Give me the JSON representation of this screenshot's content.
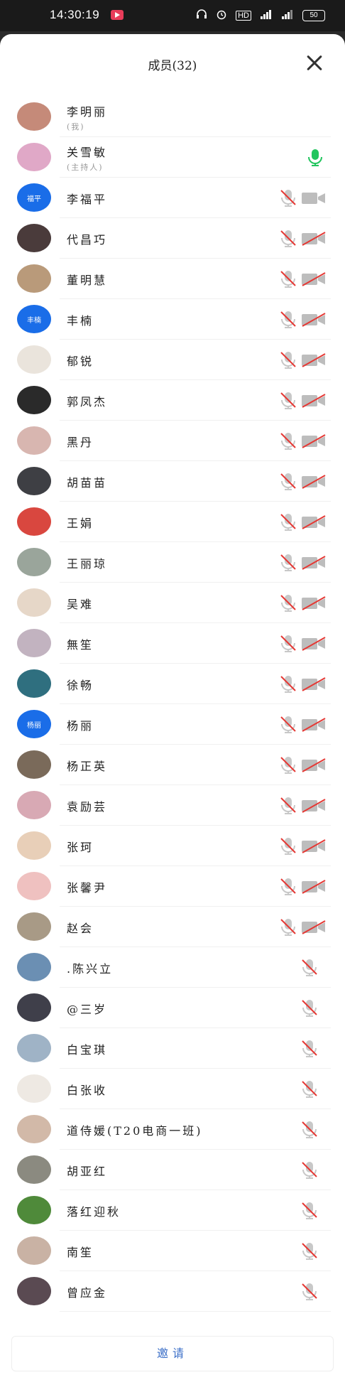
{
  "status": {
    "time": "14:30:19",
    "battery": "50"
  },
  "header": {
    "title": "成员(32)"
  },
  "invite_label": "邀请",
  "colors": {
    "accent": "#3a6ec7",
    "mic_on": "#22c55e",
    "muted_red": "#e53935",
    "text_badge": "#1a6de8"
  },
  "members": [
    {
      "name": "李明丽",
      "sub": "(我)",
      "avatar": {
        "bg": "#c58a79",
        "text": ""
      },
      "mic": "none",
      "cam": "none"
    },
    {
      "name": "关雪敏",
      "sub": "(主持人)",
      "avatar": {
        "bg": "#e0a8c7",
        "text": ""
      },
      "mic": "on",
      "cam": "none"
    },
    {
      "name": "李福平",
      "avatar": {
        "bg": "#1a6de8",
        "text": "福平"
      },
      "mic": "muted",
      "cam": "on"
    },
    {
      "name": "代昌巧",
      "avatar": {
        "bg": "#4a3b3b",
        "text": ""
      },
      "mic": "muted",
      "cam": "off"
    },
    {
      "name": "董明慧",
      "avatar": {
        "bg": "#b99a7a",
        "text": ""
      },
      "mic": "muted",
      "cam": "off"
    },
    {
      "name": "丰楠",
      "avatar": {
        "bg": "#1a6de8",
        "text": "丰楠"
      },
      "mic": "muted",
      "cam": "off"
    },
    {
      "name": "郁锐",
      "avatar": {
        "bg": "#eae4dc",
        "text": ""
      },
      "mic": "muted",
      "cam": "off"
    },
    {
      "name": "郭凤杰",
      "avatar": {
        "bg": "#2a2a2a",
        "text": ""
      },
      "mic": "muted",
      "cam": "off"
    },
    {
      "name": "黑丹",
      "avatar": {
        "bg": "#d8b6b0",
        "text": ""
      },
      "mic": "muted",
      "cam": "off"
    },
    {
      "name": "胡苗苗",
      "avatar": {
        "bg": "#3e3f44",
        "text": ""
      },
      "mic": "muted",
      "cam": "off"
    },
    {
      "name": "王娟",
      "avatar": {
        "bg": "#d9473f",
        "text": ""
      },
      "mic": "muted",
      "cam": "off"
    },
    {
      "name": "王丽琼",
      "avatar": {
        "bg": "#9aa59b",
        "text": ""
      },
      "mic": "muted",
      "cam": "off"
    },
    {
      "name": "吴难",
      "avatar": {
        "bg": "#e6d7c8",
        "text": ""
      },
      "mic": "muted",
      "cam": "off"
    },
    {
      "name": "無笙",
      "avatar": {
        "bg": "#c2b3c0",
        "text": ""
      },
      "mic": "muted",
      "cam": "off"
    },
    {
      "name": "徐畅",
      "avatar": {
        "bg": "#2f6f7f",
        "text": ""
      },
      "mic": "muted",
      "cam": "off"
    },
    {
      "name": "杨丽",
      "avatar": {
        "bg": "#1a6de8",
        "text": "杨丽"
      },
      "mic": "muted",
      "cam": "off"
    },
    {
      "name": "杨正英",
      "avatar": {
        "bg": "#7a6a5a",
        "text": ""
      },
      "mic": "muted",
      "cam": "off"
    },
    {
      "name": "袁励芸",
      "avatar": {
        "bg": "#d8a9b4",
        "text": ""
      },
      "mic": "muted",
      "cam": "off"
    },
    {
      "name": "张珂",
      "avatar": {
        "bg": "#e8cfb8",
        "text": ""
      },
      "mic": "muted",
      "cam": "off"
    },
    {
      "name": "张馨尹",
      "avatar": {
        "bg": "#efc1c0",
        "text": ""
      },
      "mic": "muted",
      "cam": "off"
    },
    {
      "name": "赵会",
      "avatar": {
        "bg": "#a89a86",
        "text": ""
      },
      "mic": "muted",
      "cam": "off"
    },
    {
      "name": ".陈兴立",
      "avatar": {
        "bg": "#6b8fb3",
        "text": ""
      },
      "mic": "muted",
      "cam": "none"
    },
    {
      "name": "@三岁",
      "avatar": {
        "bg": "#3f3f4a",
        "text": ""
      },
      "mic": "muted",
      "cam": "none"
    },
    {
      "name": "白宝琪",
      "avatar": {
        "bg": "#9fb3c6",
        "text": ""
      },
      "mic": "muted",
      "cam": "none"
    },
    {
      "name": "白张收",
      "avatar": {
        "bg": "#eee9e3",
        "text": ""
      },
      "mic": "muted",
      "cam": "none"
    },
    {
      "name": "道侍媛(T20电商一班)",
      "avatar": {
        "bg": "#d2b9a8",
        "text": ""
      },
      "mic": "muted",
      "cam": "none"
    },
    {
      "name": "胡亚红",
      "avatar": {
        "bg": "#8b8a80",
        "text": ""
      },
      "mic": "muted",
      "cam": "none"
    },
    {
      "name": "落红迎秋",
      "avatar": {
        "bg": "#4f8a3a",
        "text": ""
      },
      "mic": "muted",
      "cam": "none"
    },
    {
      "name": "南笙",
      "avatar": {
        "bg": "#c9b2a4",
        "text": ""
      },
      "mic": "muted",
      "cam": "none"
    },
    {
      "name": "曾应金",
      "avatar": {
        "bg": "#5a4a52",
        "text": ""
      },
      "mic": "muted",
      "cam": "none"
    }
  ]
}
